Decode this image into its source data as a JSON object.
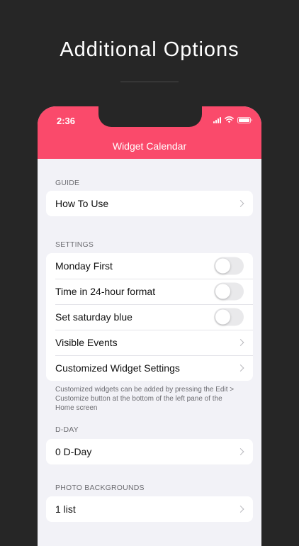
{
  "headline": "Additional Options",
  "status_bar": {
    "time": "2:36"
  },
  "nav": {
    "title": "Widget Calendar"
  },
  "guide": {
    "label": "GUIDE",
    "items": [
      {
        "label": "How To Use"
      }
    ]
  },
  "settings": {
    "label": "SETTINGS",
    "items": [
      {
        "label": "Monday First",
        "toggle": false
      },
      {
        "label": "Time in 24-hour format",
        "toggle": false
      },
      {
        "label": "Set saturday blue",
        "toggle": false
      },
      {
        "label": "Visible Events"
      },
      {
        "label": "Customized Widget Settings"
      }
    ],
    "footnote": "Customized widgets can be added by pressing the Edit > Customize button at the bottom of the left pane of the Home screen"
  },
  "dday": {
    "label": "D-DAY",
    "items": [
      {
        "label": "0 D-Day"
      }
    ]
  },
  "photo": {
    "label": "PHOTO BACKGROUNDS",
    "items": [
      {
        "label": "1 list"
      }
    ]
  },
  "colors": {
    "accent": "#fa4a6b",
    "background": "#262626",
    "list_bg": "#f2f2f7"
  }
}
